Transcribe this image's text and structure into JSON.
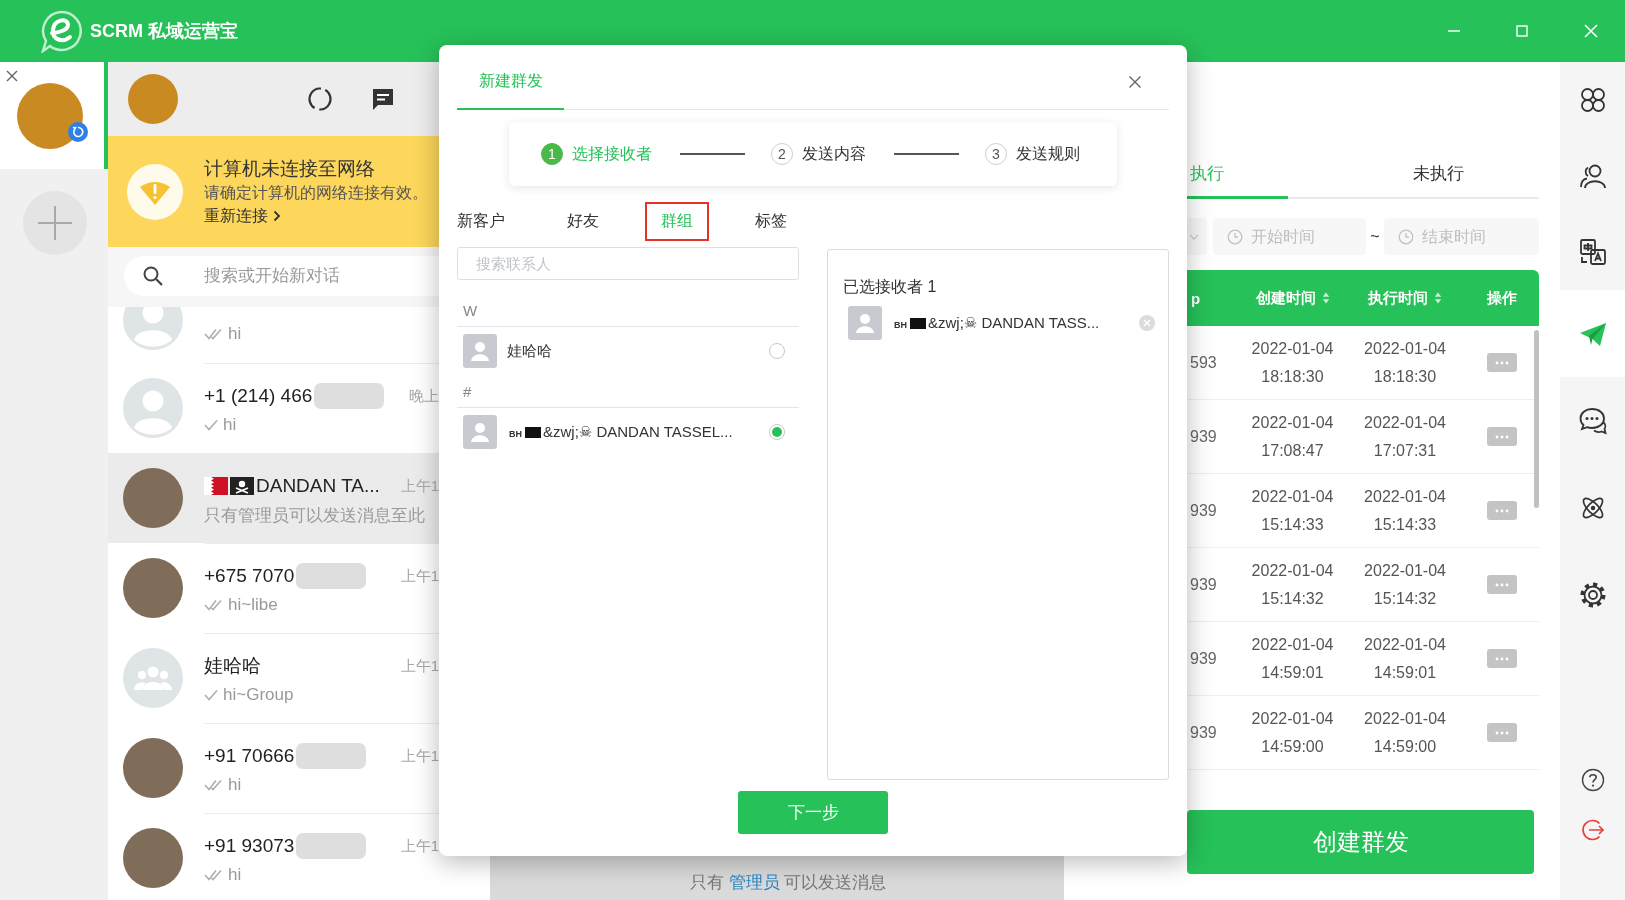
{
  "window": {
    "title": "SCRM 私域运营宝"
  },
  "accounts": [
    {
      "selected": true
    }
  ],
  "offline_banner": {
    "title": "计算机未连接至网络",
    "message": "请确定计算机的网络连接有效。",
    "action": "重新连接"
  },
  "chat_search": {
    "placeholder": "搜索或开始新对话"
  },
  "chats": [
    {
      "kind": "partial",
      "avatar": {
        "kind": "default"
      },
      "tick": {
        "kind": "double"
      },
      "message": "hi",
      "selected": false
    },
    {
      "kind": "contact",
      "avatar": {
        "kind": "default"
      },
      "name": "+1 (214) 466",
      "redacted": true,
      "time": "晚上",
      "tick": {
        "kind": "single"
      },
      "message": "hi",
      "selected": false
    },
    {
      "kind": "flagged",
      "avatar": {
        "kind": "photo"
      },
      "name": "DANDAN TA...",
      "redacted": false,
      "time": "上午1",
      "message": "只有管理员可以发送消息至此",
      "selected": true
    },
    {
      "kind": "contact",
      "avatar": {
        "kind": "photo"
      },
      "name": "+675 7070",
      "redacted": true,
      "time": "上午1",
      "tick": {
        "kind": "double"
      },
      "message": "hi~libe",
      "selected": false
    },
    {
      "kind": "contact",
      "avatar": {
        "kind": "group"
      },
      "name": "娃哈哈",
      "redacted": false,
      "time": "上午1",
      "tick": {
        "kind": "single"
      },
      "message": "hi~Group",
      "selected": false
    },
    {
      "kind": "contact",
      "avatar": {
        "kind": "photo"
      },
      "name": "+91 70666",
      "redacted": true,
      "time": "上午1",
      "tick": {
        "kind": "double"
      },
      "message": "hi",
      "selected": false
    },
    {
      "kind": "contact",
      "avatar": {
        "kind": "photo"
      },
      "name": "+91 93073",
      "redacted": true,
      "time": "上午1",
      "tick": {
        "kind": "double"
      },
      "message": "hi",
      "selected": false
    }
  ],
  "chat_footer": {
    "before": "只有",
    "link": "管理员",
    "after": "可以发送消息"
  },
  "dialog": {
    "tab": "新建群发",
    "steps": [
      {
        "number": "1",
        "label": "选择接收者",
        "active": true
      },
      {
        "number": "2",
        "label": "发送内容",
        "active": false
      },
      {
        "number": "3",
        "label": "发送规则",
        "active": false
      }
    ],
    "categories": [
      {
        "label": "新客户",
        "selected": false,
        "highlighted": false
      },
      {
        "label": "好友",
        "selected": false,
        "highlighted": false
      },
      {
        "label": "群组",
        "selected": true,
        "highlighted": true
      },
      {
        "label": "标签",
        "selected": false,
        "highlighted": false
      }
    ],
    "search": {
      "placeholder": "搜索联系人"
    },
    "groups": [
      {
        "letter": "W",
        "contacts": [
          {
            "kind": "plain",
            "name": "娃哈哈",
            "selected": false
          }
        ]
      },
      {
        "letter": "#",
        "contacts": [
          {
            "kind": "flag_fallback",
            "prefix": "BH",
            "name": "&zwj;☠ DANDAN TASSEL...",
            "selected": true
          }
        ]
      }
    ],
    "chosen": {
      "title": "已选接收者 1",
      "items": [
        {
          "kind": "flag_fallback",
          "prefix": "BH",
          "name": "&zwj;☠ DANDAN TASS..."
        }
      ]
    },
    "next_button": "下一步"
  },
  "tasks": {
    "tabs": [
      {
        "label": "执行",
        "selected": true
      },
      {
        "label": "未执行",
        "selected": false
      }
    ],
    "start_placeholder": "开始时间",
    "range_separator": "~",
    "end_placeholder": "结束时间",
    "table": {
      "columns": [
        {
          "label": "p",
          "kind": "text",
          "sortable": false
        },
        {
          "label": "创建时间",
          "kind": "text",
          "sortable": true
        },
        {
          "label": "执行时间",
          "kind": "text",
          "sortable": true
        },
        {
          "label": "操作",
          "kind": "actions",
          "sortable": false
        }
      ],
      "rows": [
        {
          "cells": [
            "593",
            "2022-01-04 18:18:30",
            "2022-01-04 18:18:30"
          ]
        },
        {
          "cells": [
            "939",
            "2022-01-04 17:08:47",
            "2022-01-04 17:07:31"
          ]
        },
        {
          "cells": [
            "939",
            "2022-01-04 15:14:33",
            "2022-01-04 15:14:33"
          ]
        },
        {
          "cells": [
            "939",
            "2022-01-04 15:14:32",
            "2022-01-04 15:14:32"
          ]
        },
        {
          "cells": [
            "939",
            "2022-01-04 14:59:01",
            "2022-01-04 14:59:01"
          ]
        },
        {
          "cells": [
            "939",
            "2022-01-04 14:59:00",
            "2022-01-04 14:59:00"
          ]
        }
      ]
    },
    "create_button": "创建群发"
  },
  "sidebar": {
    "items": [
      {
        "selected": false
      },
      {
        "selected": false
      },
      {
        "selected": false
      },
      {
        "selected": true
      },
      {
        "selected": false
      },
      {
        "selected": false
      },
      {
        "selected": false
      }
    ]
  }
}
